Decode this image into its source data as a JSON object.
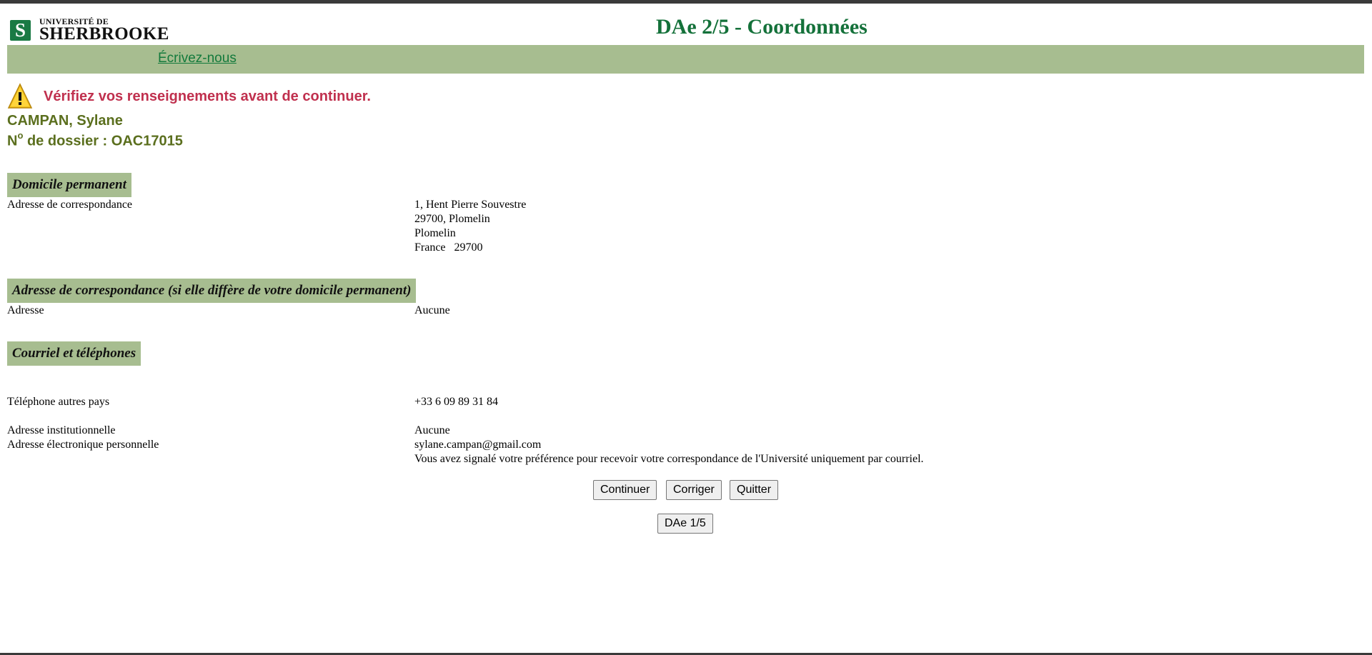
{
  "header": {
    "logo_top": "UNIVERSITÉ DE",
    "logo_main": "SHERBROOKE",
    "logo_badge": "S",
    "title": "DAe 2/5 - Coordonnées"
  },
  "nav": {
    "contact_link": "Écrivez-nous"
  },
  "warning": {
    "icon": "warning-triangle-icon",
    "text": "Vérifiez vos renseignements avant de continuer."
  },
  "person": {
    "name": "CAMPAN, Sylane",
    "dossier_prefix": "N",
    "dossier_sup": "o",
    "dossier_rest": " de dossier : OAC17015"
  },
  "sections": {
    "permanent": {
      "title": "Domicile permanent",
      "label": "Adresse de correspondance",
      "lines": [
        "1, Hent Pierre Souvestre",
        "29700, Plomelin",
        "Plomelin",
        "France   29700"
      ]
    },
    "correspondence": {
      "title": "Adresse de correspondance (si elle diffère de votre domicile permanent)",
      "label": "Adresse",
      "value": "Aucune"
    },
    "contact": {
      "title": "Courriel et téléphones",
      "phone_label": "Téléphone autres pays",
      "phone_value": "+33 6 09 89 31 84",
      "inst_label": "Adresse institutionnelle",
      "inst_value": "Aucune",
      "email_label": "Adresse électronique personnelle",
      "email_value": "sylane.campan@gmail.com",
      "preference_note": "Vous avez signalé votre préférence pour recevoir votre correspondance de l'Université uniquement par courriel."
    }
  },
  "buttons": {
    "continue": "Continuer",
    "correct": "Corriger",
    "quit": "Quitter",
    "step1": "DAe 1/5"
  },
  "colors": {
    "brand_green": "#14713a",
    "band_green": "#a7bd90",
    "warning_red": "#c0304e",
    "olive": "#5b6f1e"
  }
}
